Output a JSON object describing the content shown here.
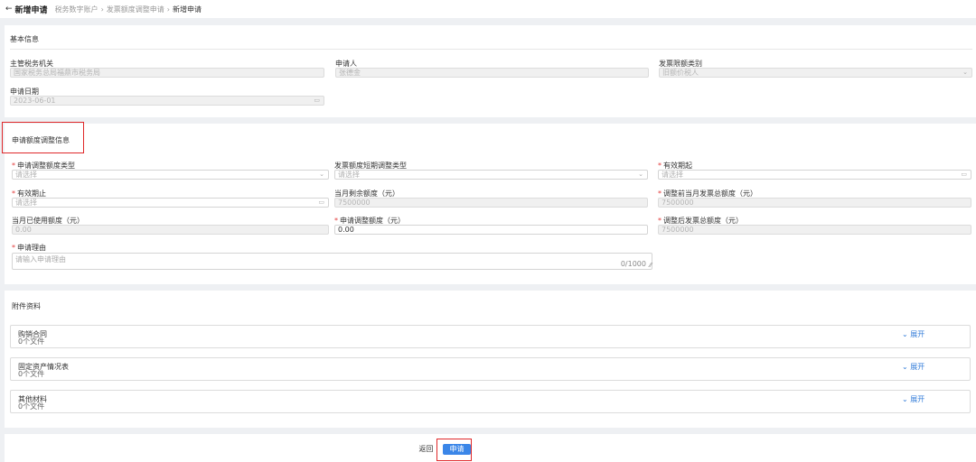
{
  "header": {
    "back_glyph": "←",
    "title": "新增申请",
    "breadcrumbs": [
      "税务数字账户",
      "发票额度调整申请",
      "新增申请"
    ],
    "separator": "›"
  },
  "basic_info": {
    "title": "基本信息",
    "tax_authority": {
      "label": "主管税务机关",
      "value": "国家税务总局福鼎市税务局"
    },
    "applicant": {
      "label": "申请人",
      "value": "张德金"
    },
    "invoice_quota_type": {
      "label": "发票限额类别",
      "value": "旧额价税人"
    },
    "apply_date": {
      "label": "申请日期",
      "value": "2023-06-01"
    }
  },
  "adjust_info": {
    "title": "申请额度调整信息",
    "adjust_type": {
      "label": "申请调整额度类型",
      "placeholder": "请选择",
      "required": "*"
    },
    "short_term_type": {
      "label": "发票额度短期调整类型",
      "placeholder": "请选择"
    },
    "valid_from": {
      "label": "有效期起",
      "placeholder": "请选择",
      "required": "*"
    },
    "valid_to": {
      "label": "有效期止",
      "placeholder": "请选择",
      "required": "*"
    },
    "remaining": {
      "label": "当月剩余额度（元）",
      "value": "7500000"
    },
    "total_before": {
      "label": "调整前当月发票总额度（元）",
      "value": "7500000",
      "required": "*"
    },
    "used": {
      "label": "当月已使用额度（元）",
      "value": "0.00"
    },
    "apply_amount": {
      "label": "申请调整额度（元）",
      "value": "0.00",
      "required": "*"
    },
    "total_after": {
      "label": "调整后发票总额度（元）",
      "value": "7500000",
      "required": "*"
    },
    "reason": {
      "label": "申请理由",
      "placeholder": "请输入申请理由",
      "counter": "0/1000",
      "required": "*"
    }
  },
  "attachments": {
    "title": "附件资料",
    "expand_label": "⌄ 展开",
    "items": [
      {
        "name": "购销合同",
        "count": "0个文件"
      },
      {
        "name": "固定资产情况表",
        "count": "0个文件"
      },
      {
        "name": "其他材料",
        "count": "0个文件"
      }
    ]
  },
  "footer": {
    "back_label": "返回",
    "submit_label": "申请"
  },
  "icons": {
    "chevron": "⌄",
    "calendar": "▭",
    "resize": "⁄⁄"
  },
  "colors": {
    "primary": "#3a86e8",
    "highlight": "#e0282a",
    "required": "#e23c3c"
  }
}
